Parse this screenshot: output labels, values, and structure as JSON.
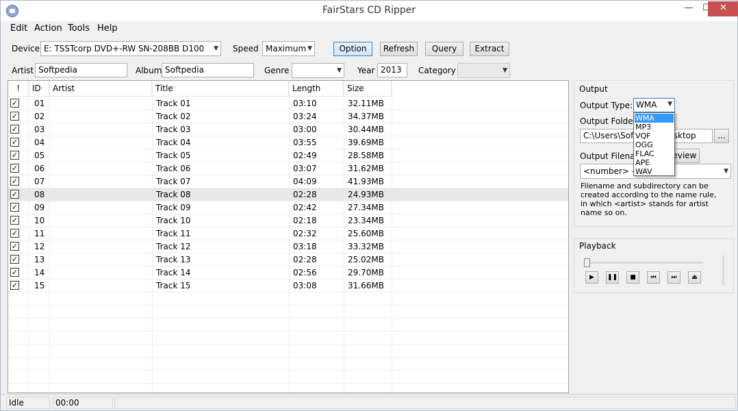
{
  "window": {
    "title": "FairStars CD Ripper",
    "min": "—",
    "max": "☐",
    "close": "✕"
  },
  "menu": [
    "Edit",
    "Action",
    "Tools",
    "Help"
  ],
  "toolbar": {
    "device_label": "Device",
    "device_value": "E: TSSTcorp DVD+-RW SN-208BB D100",
    "speed_label": "Speed",
    "speed_value": "Maximum",
    "option": "Option",
    "refresh": "Refresh",
    "query": "Query",
    "extract": "Extract"
  },
  "album": {
    "artist_label": "Artist",
    "artist_value": "Softpedia",
    "album_label": "Album",
    "album_value": "Softpedia",
    "genre_label": "Genre",
    "genre_value": "",
    "year_label": "Year",
    "year_value": "2013",
    "category_label": "Category",
    "category_value": ""
  },
  "table": {
    "headers": [
      "!",
      "ID",
      "Artist",
      "Title",
      "Length",
      "Size"
    ],
    "rows": [
      {
        "checked": true,
        "id": "01",
        "artist": "",
        "title": "Track 01",
        "length": "03:10",
        "size": "32.11MB"
      },
      {
        "checked": true,
        "id": "02",
        "artist": "",
        "title": "Track 02",
        "length": "03:24",
        "size": "34.37MB"
      },
      {
        "checked": true,
        "id": "03",
        "artist": "",
        "title": "Track 03",
        "length": "03:00",
        "size": "30.44MB"
      },
      {
        "checked": true,
        "id": "04",
        "artist": "",
        "title": "Track 04",
        "length": "03:55",
        "size": "39.69MB"
      },
      {
        "checked": true,
        "id": "05",
        "artist": "",
        "title": "Track 05",
        "length": "02:49",
        "size": "28.58MB"
      },
      {
        "checked": true,
        "id": "06",
        "artist": "",
        "title": "Track 06",
        "length": "03:07",
        "size": "31.62MB"
      },
      {
        "checked": true,
        "id": "07",
        "artist": "",
        "title": "Track 07",
        "length": "04:09",
        "size": "41.93MB"
      },
      {
        "checked": true,
        "id": "08",
        "artist": "",
        "title": "Track 08",
        "length": "02:28",
        "size": "24.93MB"
      },
      {
        "checked": true,
        "id": "09",
        "artist": "",
        "title": "Track 09",
        "length": "02:42",
        "size": "27.34MB"
      },
      {
        "checked": true,
        "id": "10",
        "artist": "",
        "title": "Track 10",
        "length": "02:18",
        "size": "23.34MB"
      },
      {
        "checked": true,
        "id": "11",
        "artist": "",
        "title": "Track 11",
        "length": "02:32",
        "size": "25.60MB"
      },
      {
        "checked": true,
        "id": "12",
        "artist": "",
        "title": "Track 12",
        "length": "03:18",
        "size": "33.32MB"
      },
      {
        "checked": true,
        "id": "13",
        "artist": "",
        "title": "Track 13",
        "length": "02:28",
        "size": "25.02MB"
      },
      {
        "checked": true,
        "id": "14",
        "artist": "",
        "title": "Track 14",
        "length": "02:56",
        "size": "29.70MB"
      },
      {
        "checked": true,
        "id": "15",
        "artist": "",
        "title": "Track 15",
        "length": "03:08",
        "size": "31.66MB"
      }
    ]
  },
  "output": {
    "section": "Output",
    "type_label": "Output Type:",
    "type_value": "WMA",
    "type_options": [
      "WMA",
      "MP3",
      "VQF",
      "OGG",
      "FLAC",
      "APE",
      "WAV"
    ],
    "folder_label": "Output Folder:",
    "folder_value": "C:\\Users\\Softpedia\\Desktop",
    "browse": "...",
    "filename_label": "Output Filename",
    "preview": "Preview",
    "filename_value": "<number> - <title>",
    "description": "Filename and subdirectory can be created according to the name rule, in which <artist> stands for artist name so on."
  },
  "playback": {
    "section": "Playback"
  },
  "status": {
    "state": "Idle",
    "time": "00:00"
  }
}
